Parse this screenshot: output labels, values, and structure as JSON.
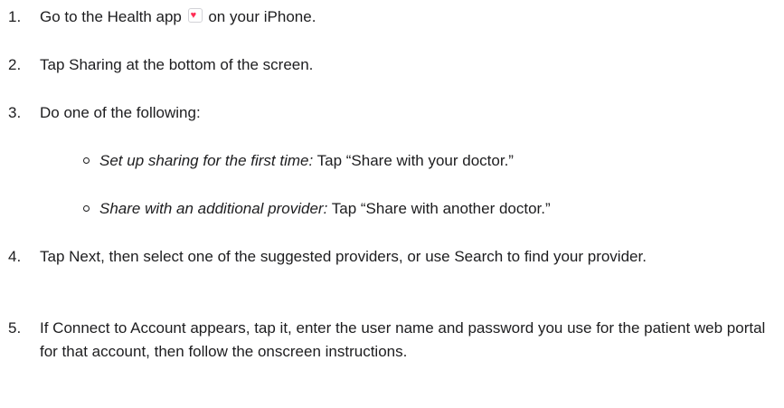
{
  "steps": [
    {
      "num": "1.",
      "before_icon": "Go to the Health app ",
      "icon": "health-app-icon",
      "after_icon": " on your iPhone."
    },
    {
      "num": "2.",
      "text": "Tap Sharing at the bottom of the screen."
    },
    {
      "num": "3.",
      "text": "Do one of the following:",
      "sub": [
        {
          "italic": "Set up sharing for the first time:",
          "rest": " Tap “Share with your doctor.”"
        },
        {
          "italic": "Share with an additional provider:",
          "rest": " Tap “Share with another doctor.”"
        }
      ]
    },
    {
      "num": "4.",
      "text": "Tap Next, then select one of the suggested providers, or use Search to find your provider."
    },
    {
      "num": "5.",
      "text": "If Connect to Account appears, tap it, enter the user name and password you use for the patient web portal for that account, then follow the onscreen instructions."
    }
  ]
}
